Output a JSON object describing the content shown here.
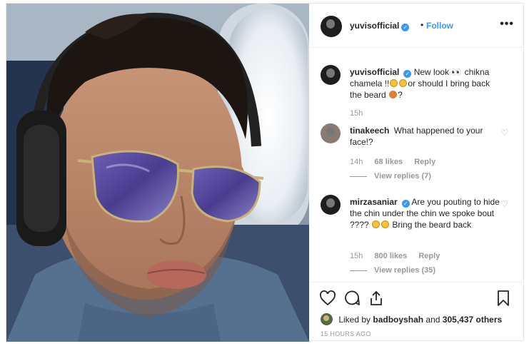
{
  "post": {
    "username": "yuvisofficial",
    "verified_mark": "✓",
    "separator": "•",
    "follow_label": "Follow",
    "more_label": "•••"
  },
  "caption": {
    "username": "yuvisofficial",
    "text_part1": "New look 👀 chikna chamela !!",
    "text_part2": "or should I bring back the beard",
    "text_part3": "?",
    "time": "15h"
  },
  "comments": [
    {
      "username": "tinakeech",
      "text": "What happened to your face!?",
      "time": "14h",
      "likes": "68 likes",
      "reply_label": "Reply",
      "view_replies": "View replies (7)"
    },
    {
      "username": "mirzasaniar",
      "text_part1": "Are you pouting to hide the chin under the chin we spoke bout ????",
      "text_part2": "Bring the beard back",
      "time": "15h",
      "likes": "800 likes",
      "reply_label": "Reply",
      "view_replies": "View replies (35)"
    }
  ],
  "actions": {
    "liked_by_prefix": "Liked by",
    "liked_by_user": "badboyshah",
    "liked_by_and": "and",
    "liked_by_count": "305,437 others",
    "timestamp": "15 HOURS AGO"
  },
  "colors": {
    "link_blue": "#3897f0",
    "meta_gray": "#999999",
    "text": "#262626"
  },
  "icons": [
    "more-icon",
    "heart-icon",
    "comment-icon",
    "share-icon",
    "bookmark-icon",
    "verified-icon",
    "small-heart-icon"
  ]
}
